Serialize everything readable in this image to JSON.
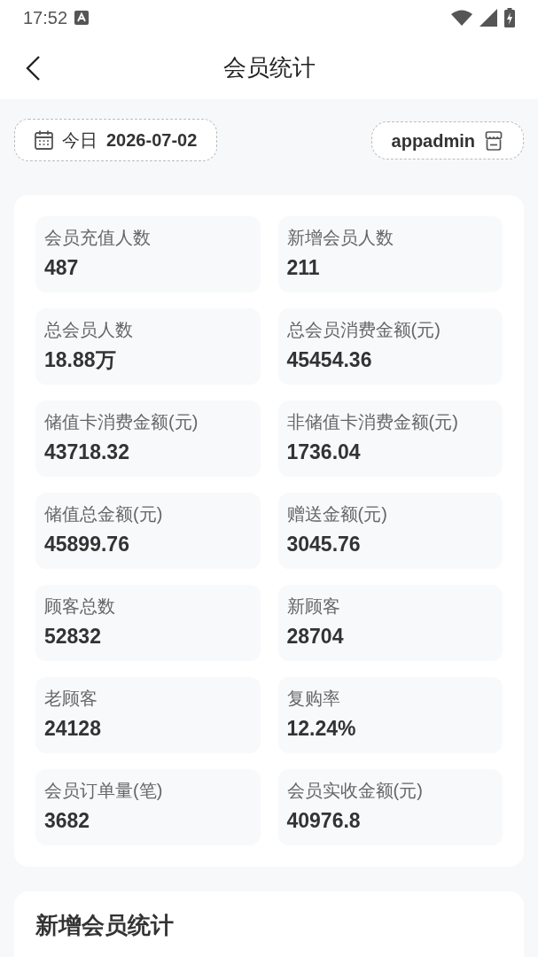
{
  "status_bar": {
    "time": "17:52"
  },
  "header": {
    "title": "会员统计"
  },
  "filters": {
    "date_range": "今日",
    "date": "2026-07-02",
    "store": "appadmin"
  },
  "stats": [
    {
      "label": "会员充值人数",
      "value": "487"
    },
    {
      "label": "新增会员人数",
      "value": "211"
    },
    {
      "label": "总会员人数",
      "value": "18.88万"
    },
    {
      "label": "总会员消费金额(元)",
      "value": "45454.36"
    },
    {
      "label": "储值卡消费金额(元)",
      "value": "43718.32"
    },
    {
      "label": "非储值卡消费金额(元)",
      "value": "1736.04"
    },
    {
      "label": "储值总金额(元)",
      "value": "45899.76"
    },
    {
      "label": "赠送金额(元)",
      "value": "3045.76"
    },
    {
      "label": "顾客总数",
      "value": "52832"
    },
    {
      "label": "新顾客",
      "value": "28704"
    },
    {
      "label": "老顾客",
      "value": "24128"
    },
    {
      "label": "复购率",
      "value": "12.24%"
    },
    {
      "label": "会员订单量(笔)",
      "value": "3682"
    },
    {
      "label": "会员实收金额(元)",
      "value": "40976.8"
    }
  ],
  "sections": [
    {
      "title": "新增会员统计"
    }
  ]
}
